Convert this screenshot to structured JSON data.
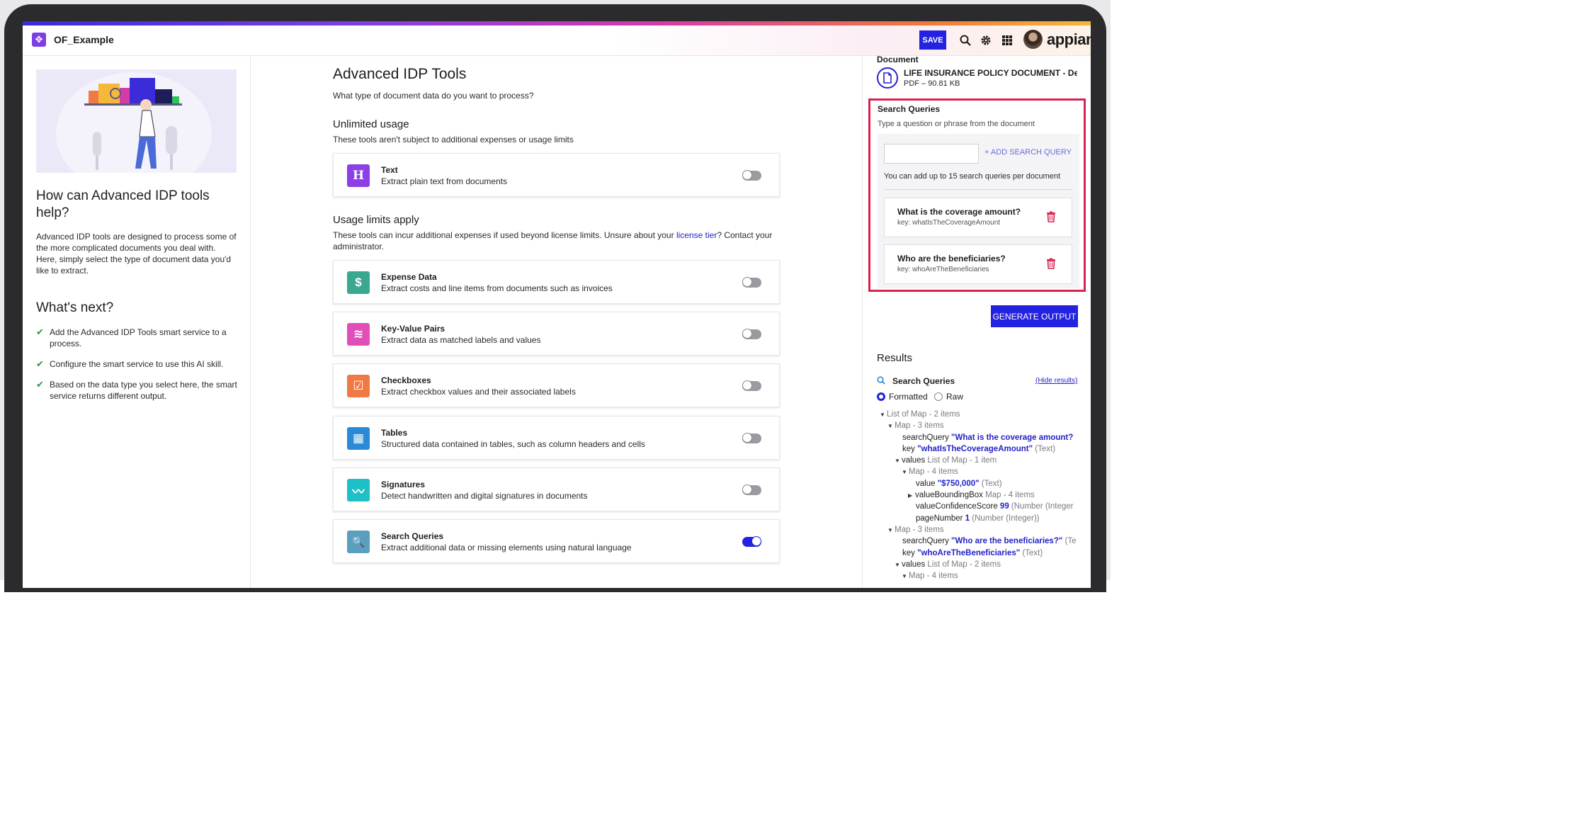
{
  "header": {
    "app_title": "OF_Example",
    "save_label": "SAVE",
    "brand": "appian",
    "icons": [
      "search-icon",
      "gear-icon",
      "apps-grid-icon"
    ]
  },
  "left": {
    "help_title": "How can Advanced IDP tools help?",
    "help_desc": "Advanced IDP tools are designed to process some of the more complicated documents you deal with. Here, simply select the type of document data you'd like to extract.",
    "next_title": "What's next?",
    "next_items": [
      "Add the Advanced IDP Tools smart service to a process.",
      "Configure the smart service to use this AI skill.",
      "Based on the data type you select here, the smart service returns different output."
    ]
  },
  "center": {
    "title": "Advanced IDP Tools",
    "subtitle": "What type of document data do you want to process?",
    "unlimited_title": "Unlimited usage",
    "unlimited_desc": "These tools aren't subject to additional expenses or usage limits",
    "limits_title": "Usage limits apply",
    "limits_desc_1": "These tools can incur additional expenses if used beyond license limits. Unsure about your ",
    "limits_link": "license tier",
    "limits_desc_2": "? Contact your administrator.",
    "tools": [
      {
        "name": "Text",
        "desc": "Extract plain text from documents",
        "icon": "H",
        "color": "#8b3fe4",
        "enabled": false
      },
      {
        "name": "Expense Data",
        "desc": "Extract costs and line items from documents such as invoices",
        "icon": "$",
        "color": "#3aa88e",
        "enabled": false
      },
      {
        "name": "Key-Value Pairs",
        "desc": "Extract data as matched labels and values",
        "icon": "≋",
        "color": "#e04fb8",
        "enabled": false
      },
      {
        "name": "Checkboxes",
        "desc": "Extract checkbox values and their associated labels",
        "icon": "☑",
        "color": "#f07a45",
        "enabled": false
      },
      {
        "name": "Tables",
        "desc": "Structured data contained in tables, such as column headers and cells",
        "icon": "▦",
        "color": "#2a8ad8",
        "enabled": false
      },
      {
        "name": "Signatures",
        "desc": "Detect handwritten and digital signatures in documents",
        "icon": "〰",
        "color": "#1ec0c8",
        "enabled": false
      },
      {
        "name": "Search Queries",
        "desc": "Extract additional data or missing elements using natural language",
        "icon": "🔍",
        "color": "#5a9fbe",
        "enabled": true
      }
    ]
  },
  "right": {
    "doc_label": "Document",
    "doc_name": "LIFE INSURANCE POLICY DOCUMENT - De...",
    "doc_meta": "PDF – 90.81 KB",
    "sq_title": "Search Queries",
    "sq_sub": "Type a question or phrase from the document",
    "sq_input_value": "",
    "add_query": "+ ADD SEARCH QUERY",
    "sq_limit": "You can add up to 15 search queries per document",
    "queries": [
      {
        "text": "What is the coverage amount?",
        "key": "key: whatIsTheCoverageAmount"
      },
      {
        "text": "Who are the beneficiaries?",
        "key": "key: whoAreTheBeneficiaries"
      }
    ],
    "generate": "GENERATE OUTPUT",
    "results_title": "Results",
    "results_sq": "Search Queries",
    "hide_results": "(Hide results)",
    "radio_formatted": "Formatted",
    "radio_raw": "Raw",
    "tree": {
      "r1": "List of Map - 2 items",
      "r2": "Map - 3 items",
      "r3k": "searchQuery",
      "r3v": "\"What is the coverage amount?",
      "r4k": "key",
      "r4v": "\"whatIsTheCoverageAmount\"",
      "r4t": "(Text)",
      "r5k": "values",
      "r5t": "List of Map - 1 item",
      "r6": "Map - 4 items",
      "r7k": "value",
      "r7v": "\"$750,000\"",
      "r7t": "(Text)",
      "r8k": "valueBoundingBox",
      "r8t": "Map - 4 items",
      "r9k": "valueConfidenceScore",
      "r9v": "99",
      "r9t": "(Number (Integer",
      "r10k": "pageNumber",
      "r10v": "1",
      "r10t": "(Number (Integer))",
      "r11": "Map - 3 items",
      "r12k": "searchQuery",
      "r12v": "\"Who are the beneficiaries?\"",
      "r12t": "(Te",
      "r13k": "key",
      "r13v": "\"whoAreTheBeneficiaries\"",
      "r13t": "(Text)",
      "r14k": "values",
      "r14t": "List of Map - 2 items",
      "r15": "Map - 4 items"
    }
  }
}
